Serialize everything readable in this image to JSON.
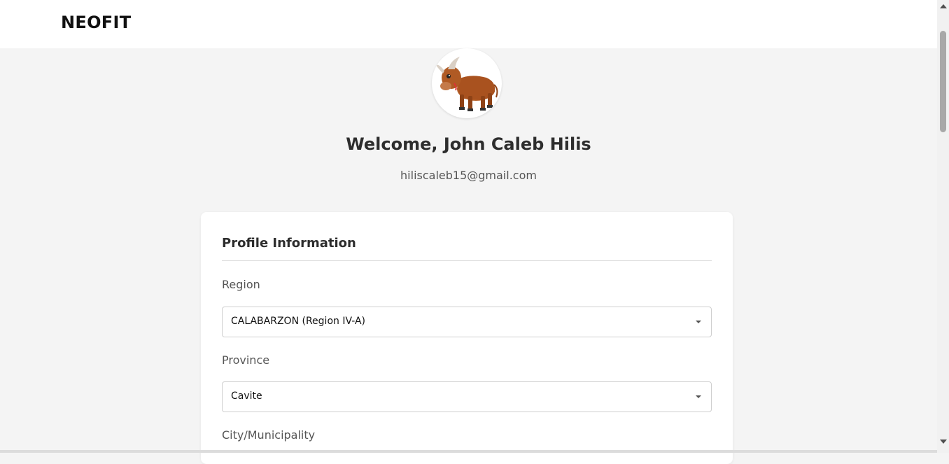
{
  "brand": {
    "name": "NEOFIT"
  },
  "user": {
    "welcome": "Welcome, John Caleb Hilis",
    "email": "hiliscaleb15@gmail.com",
    "avatar_icon": "bull-avatar-icon"
  },
  "profile": {
    "title": "Profile Information",
    "fields": [
      {
        "label": "Region",
        "value": "CALABARZON (Region IV-A)"
      },
      {
        "label": "Province",
        "value": "Cavite"
      },
      {
        "label": "City/Municipality",
        "value": ""
      }
    ]
  },
  "colors": {
    "page_bg": "#f4f4f4",
    "card_bg": "#ffffff",
    "text_dark": "#2d2d2d",
    "text_muted": "#555555"
  }
}
